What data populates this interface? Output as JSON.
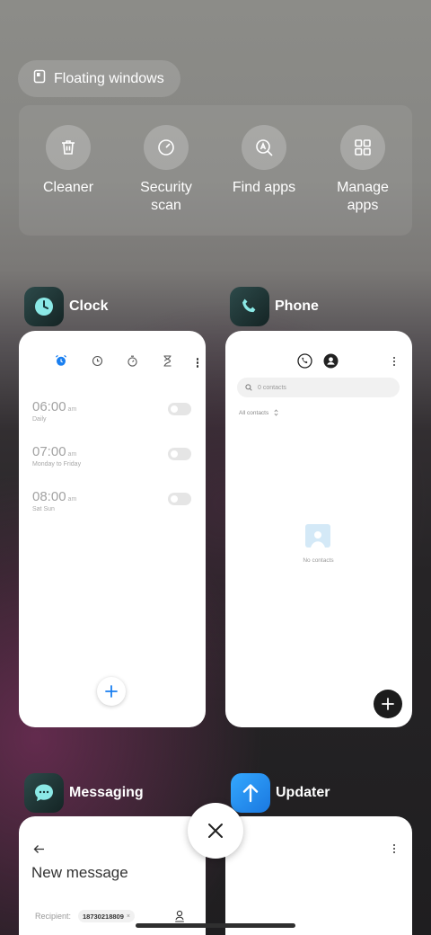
{
  "floating_windows": {
    "label": "Floating windows",
    "icon": "window-icon"
  },
  "quick_actions": [
    {
      "label": "Cleaner",
      "icon": "trash-icon"
    },
    {
      "label": "Security\nscan",
      "icon": "security-scan-icon"
    },
    {
      "label": "Find apps",
      "icon": "find-apps-icon"
    },
    {
      "label": "Manage\napps",
      "icon": "grid-icon"
    }
  ],
  "recent_apps": {
    "clock": {
      "name": "Clock",
      "icon": "clock-icon",
      "tabs": [
        "alarm-icon",
        "clock-tab-icon",
        "stopwatch-icon",
        "hourglass-icon"
      ],
      "alarms": [
        {
          "time": "06:00",
          "ampm": "am",
          "repeat": "Daily",
          "enabled": false
        },
        {
          "time": "07:00",
          "ampm": "am",
          "repeat": "Monday to Friday",
          "enabled": false
        },
        {
          "time": "08:00",
          "ampm": "am",
          "repeat": "Sat Sun",
          "enabled": false
        }
      ]
    },
    "phone": {
      "name": "Phone",
      "icon": "phone-icon",
      "search_placeholder": "0 contacts",
      "filter": "All contacts",
      "empty_text": "No contacts"
    },
    "messaging": {
      "name": "Messaging",
      "icon": "chat-bubble-icon",
      "title": "New message",
      "recipient_label": "Recipient:",
      "recipient_value": "18730218809",
      "chip_remove": "×"
    },
    "updater": {
      "name": "Updater",
      "icon": "arrow-up-icon"
    }
  },
  "colors": {
    "accent_blue": "#1a7ff0",
    "clock_icon_bg": "#1f3b3b",
    "phone_icon_bg": "#1f3b3b",
    "messaging_icon_bg": "#1f3b3b",
    "updater_icon_bg": "#1f8ff2"
  }
}
